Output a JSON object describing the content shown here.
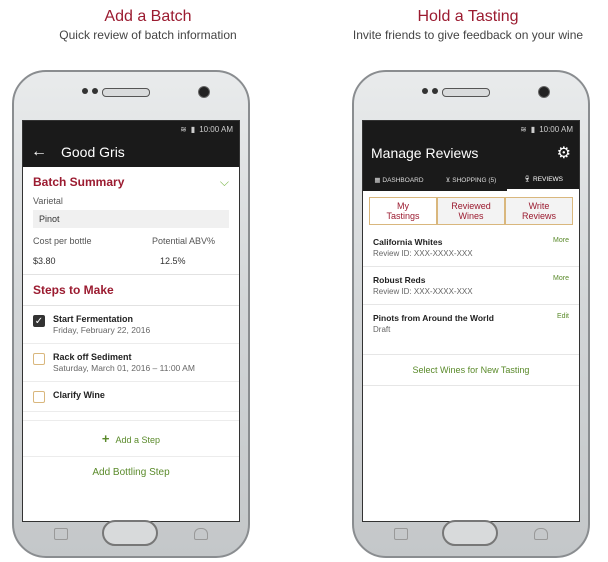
{
  "left_panel": {
    "heading": "Add a Batch",
    "subheading": "Quick review of batch information",
    "status_time": "10:00 AM",
    "app_title": "Good Gris",
    "batch_summary": {
      "title": "Batch Summary",
      "varietal_label": "Varietal",
      "varietal_value": "Pinot",
      "cost_label": "Cost per bottle",
      "cost_value": "$3.80",
      "abv_label": "Potential ABV%",
      "abv_value": "12.5%"
    },
    "steps": {
      "title": "Steps to Make",
      "items": [
        {
          "title": "Start Fermentation",
          "sub": "Friday, February 22, 2016",
          "checked": true
        },
        {
          "title": "Rack off Sediment",
          "sub": "Saturday, March 01, 2016 – 11:00 AM",
          "checked": false
        },
        {
          "title": "Clarify Wine",
          "sub": "",
          "checked": false
        }
      ],
      "add_step_label": "Add a Step",
      "add_bottling_label": "Add Bottling Step"
    }
  },
  "right_panel": {
    "heading": "Hold a Tasting",
    "subheading": "Invite friends to give feedback on your wine",
    "status_time": "10:00 AM",
    "app_title": "Manage Reviews",
    "nav_tabs": [
      "DASHBOARD",
      "SHOPPING (5)",
      "REVIEWS"
    ],
    "seg_tabs": [
      {
        "line1": "My",
        "line2": "Tastings"
      },
      {
        "line1": "Reviewed",
        "line2": "Wines"
      },
      {
        "line1": "Write",
        "line2": "Reviews"
      }
    ],
    "reviews": [
      {
        "title": "California Whites",
        "sub": "Review ID: XXX-XXXX-XXX",
        "action": "More"
      },
      {
        "title": "Robust Reds",
        "sub": "Review ID: XXX-XXXX-XXX",
        "action": "More"
      },
      {
        "title": "Pinots from Around the World",
        "sub": "Draft",
        "action": "Edit"
      }
    ],
    "select_wines_label": "Select Wines for New Tasting"
  },
  "colors": {
    "accent": "#9b1b30",
    "green": "#5a8a2a",
    "bar": "#1a1a1a"
  }
}
